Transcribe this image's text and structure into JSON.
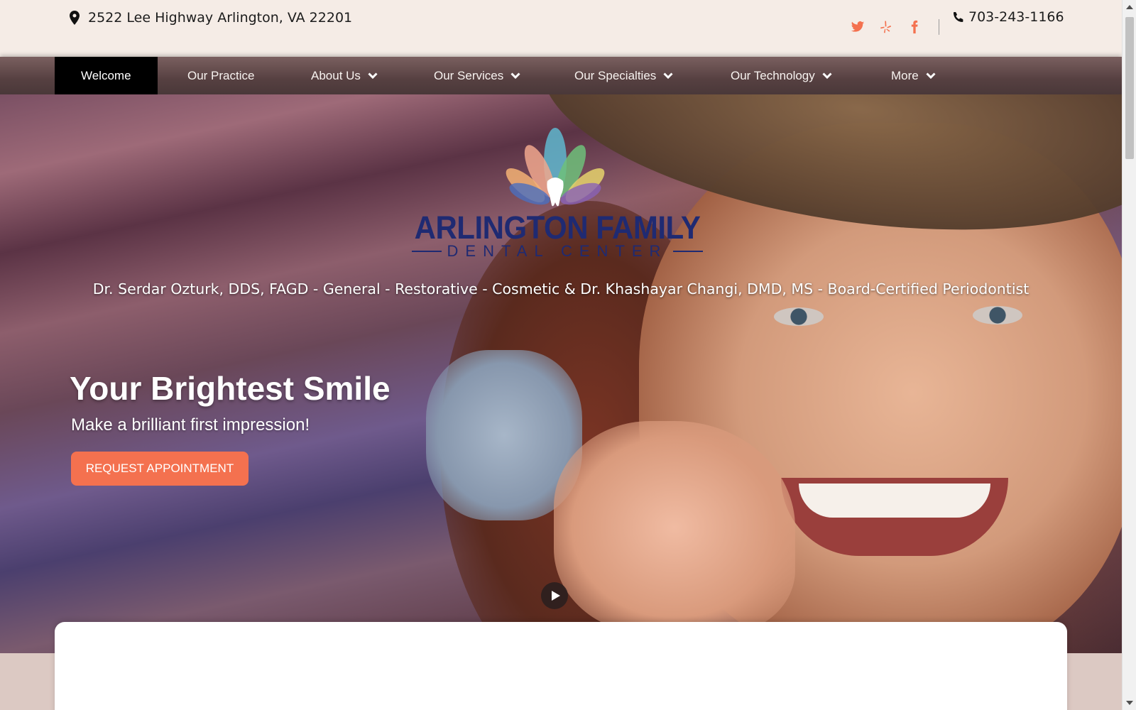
{
  "topbar": {
    "address": "2522 Lee Highway Arlington, VA 22201",
    "phone": "703-243-1166",
    "social": [
      "twitter-icon",
      "yelp-icon",
      "facebook-icon"
    ],
    "accent_color": "#f4714f"
  },
  "nav": {
    "items": [
      {
        "label": "Welcome",
        "active": true,
        "dropdown": false
      },
      {
        "label": "Our Practice",
        "active": false,
        "dropdown": false
      },
      {
        "label": "About Us",
        "active": false,
        "dropdown": true
      },
      {
        "label": "Our Services",
        "active": false,
        "dropdown": true
      },
      {
        "label": "Our Specialties",
        "active": false,
        "dropdown": true
      },
      {
        "label": "Our Technology",
        "active": false,
        "dropdown": true
      },
      {
        "label": "More",
        "active": false,
        "dropdown": true
      }
    ]
  },
  "hero": {
    "logo_title": "ARLINGTON FAMILY",
    "logo_subtitle": "DENTAL CENTER",
    "doctors_line": "Dr. Serdar Ozturk, DDS, FAGD - General - Restorative - Cosmetic & Dr. Khashayar Changi, DMD, MS - Board-Certified Periodontist",
    "headline": "Your Brightest Smile",
    "subheadline": "Make a brilliant first impression!",
    "cta_label": "REQUEST APPOINTMENT",
    "cta_color": "#f4714f",
    "logo_color": "#1f2a72"
  }
}
